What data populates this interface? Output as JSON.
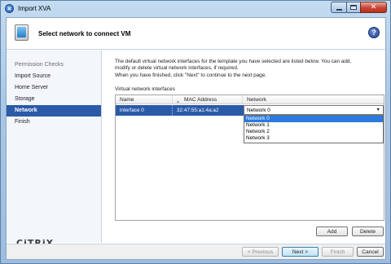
{
  "window": {
    "title": "Import XVA"
  },
  "header": {
    "title": "Select network to connect VM",
    "help_glyph": "?"
  },
  "sidebar": {
    "items": [
      {
        "label": "Permission Checks",
        "state": "muted"
      },
      {
        "label": "Import Source",
        "state": "normal"
      },
      {
        "label": "Home Server",
        "state": "normal"
      },
      {
        "label": "Storage",
        "state": "normal"
      },
      {
        "label": "Network",
        "state": "active"
      },
      {
        "label": "Finish",
        "state": "normal"
      }
    ],
    "logo_text": "CiTRiX"
  },
  "main": {
    "description_line1": "The default virtual network interfaces for the template you have selected are listed below. You can add,",
    "description_line2": "modify or delete virtual network interfaces, if required.",
    "description_line3": "When you have finished, click \"Next\" to continue to the next page.",
    "section_label": "Virtual network interfaces",
    "table": {
      "columns": [
        "Name",
        "MAC Address",
        "Network"
      ],
      "rows": [
        {
          "name": "interface 0",
          "mac": "32:47:55:a1:4a:a2",
          "network": "Network 0"
        }
      ]
    },
    "network_dropdown": {
      "selected": "Network 0",
      "options": [
        "Network 0",
        "Network 1",
        "Network 2",
        "Network 3"
      ],
      "highlighted": "Network 0"
    },
    "add_label": "Add",
    "delete_label": "Delete"
  },
  "footer": {
    "previous_label": "< Previous",
    "next_label": "Next >",
    "finish_label": "Finish",
    "cancel_label": "Cancel"
  },
  "colors": {
    "selection": "#2a5aa8",
    "dropdown_highlight": "#2a7ae0",
    "sidebar_bg": "#f3f6fa",
    "title_bar": "#a9c7e6"
  }
}
